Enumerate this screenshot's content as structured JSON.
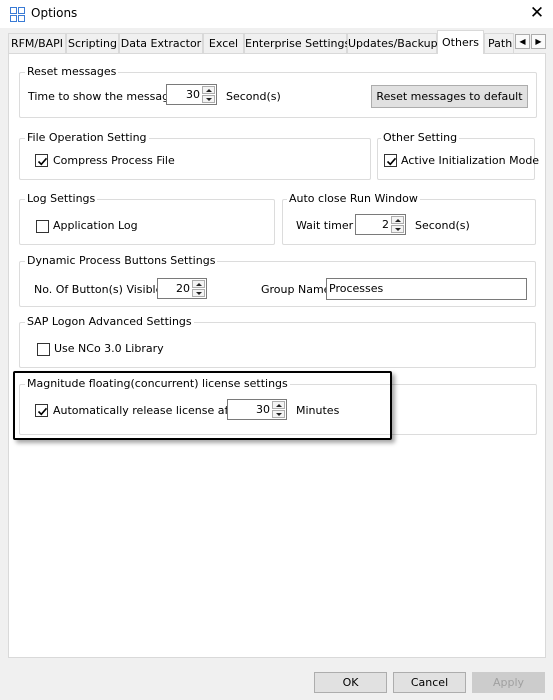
{
  "window": {
    "title": "Options",
    "close_glyph": "✕"
  },
  "tabs": [
    {
      "label": "RFM/BAPI"
    },
    {
      "label": "Scripting"
    },
    {
      "label": "Data Extractor"
    },
    {
      "label": "Excel"
    },
    {
      "label": "Enterprise Settings"
    },
    {
      "label": "Updates/Backup"
    },
    {
      "label": "Others",
      "active": true
    },
    {
      "label": "Path"
    }
  ],
  "tab_scroll": {
    "left": "◀",
    "right": "▶"
  },
  "reset_messages": {
    "title": "Reset messages",
    "time_label": "Time to show the message",
    "time_value": "30",
    "unit": "Second(s)",
    "reset_button": "Reset messages to default"
  },
  "file_operation": {
    "title": "File Operation Setting",
    "compress_label": "Compress Process File",
    "compress_checked": true
  },
  "other_setting": {
    "title": "Other Setting",
    "active_init_label": "Active Initialization Mode",
    "active_init_checked": true
  },
  "log_settings": {
    "title": "Log Settings",
    "application_log_label": "Application Log",
    "application_log_checked": false
  },
  "auto_close": {
    "title": "Auto close Run Window",
    "wait_label": "Wait timer",
    "wait_value": "2",
    "unit": "Second(s)"
  },
  "dynamic_buttons": {
    "title": "Dynamic Process Buttons Settings",
    "count_label": "No. Of Button(s) Visible",
    "count_value": "20",
    "group_label": "Group Name",
    "group_value": "Processes"
  },
  "sap_logon": {
    "title": "SAP Logon Advanced Settings",
    "nco_label": "Use NCo 3.0 Library",
    "nco_checked": false
  },
  "license": {
    "title": "Magnitude floating(concurrent) license settings",
    "auto_release_label": "Automatically release license after",
    "auto_release_checked": true,
    "minutes_value": "30",
    "unit": "Minutes"
  },
  "footer": {
    "ok": "OK",
    "cancel": "Cancel",
    "apply": "Apply"
  },
  "colors": {
    "window_bg": "#f0f0f0",
    "panel_bg": "#ffffff",
    "button_bg": "#e1e1e1",
    "disabled_text": "#a0a0a0"
  }
}
